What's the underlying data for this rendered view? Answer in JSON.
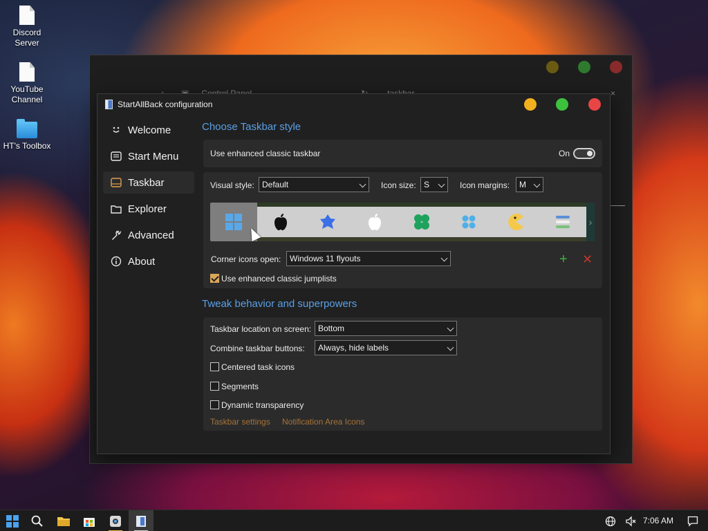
{
  "desktop": {
    "icons": [
      {
        "label_line1": "Discord",
        "label_line2": "Server"
      },
      {
        "label_line1": "YouTube",
        "label_line2": "Channel"
      },
      {
        "label_line1": "HT's Toolbox",
        "label_line2": ""
      }
    ]
  },
  "background_window": {
    "breadcrumb": "Control Panel",
    "search_value": "taskbar"
  },
  "window": {
    "title": "StartAllBack configuration",
    "traffic_colors": {
      "minimize": "#f2b01e",
      "maximize": "#3cc23c",
      "close": "#e84545"
    }
  },
  "nav": {
    "items": [
      {
        "label": "Welcome",
        "icon": "smile-icon"
      },
      {
        "label": "Start Menu",
        "icon": "start-menu-icon"
      },
      {
        "label": "Taskbar",
        "icon": "taskbar-icon"
      },
      {
        "label": "Explorer",
        "icon": "folder-icon"
      },
      {
        "label": "Advanced",
        "icon": "wrench-icon"
      },
      {
        "label": "About",
        "icon": "info-icon"
      }
    ],
    "active": "Taskbar"
  },
  "taskbar_style": {
    "heading": "Choose Taskbar style",
    "enhanced_label": "Use enhanced classic taskbar",
    "enhanced_state": "On",
    "visual_style_label": "Visual style:",
    "visual_style_value": "Default",
    "icon_size_label": "Icon size:",
    "icon_size_value": "S",
    "icon_margins_label": "Icon margins:",
    "icon_margins_value": "M",
    "style_icons": [
      "windows-11-icon",
      "apple-icon",
      "blue-blob-icon",
      "apple-white-icon",
      "green-clover-icon",
      "blue-dots-icon",
      "pacman-icon",
      "hamburger-icon"
    ],
    "corner_label": "Corner icons open:",
    "corner_value": "Windows 11 flyouts",
    "jumplists_label": "Use enhanced classic jumplists",
    "jumplists_checked": true
  },
  "tweak": {
    "heading": "Tweak behavior and superpowers",
    "location_label": "Taskbar location on screen:",
    "location_value": "Bottom",
    "combine_label": "Combine taskbar buttons:",
    "combine_value": "Always, hide labels",
    "centered_label": "Centered task icons",
    "segments_label": "Segments",
    "transparency_label": "Dynamic transparency",
    "link_taskbar_settings": "Taskbar settings",
    "link_notification_icons": "Notification Area Icons"
  },
  "system_taskbar": {
    "clock": "7:06 AM"
  }
}
